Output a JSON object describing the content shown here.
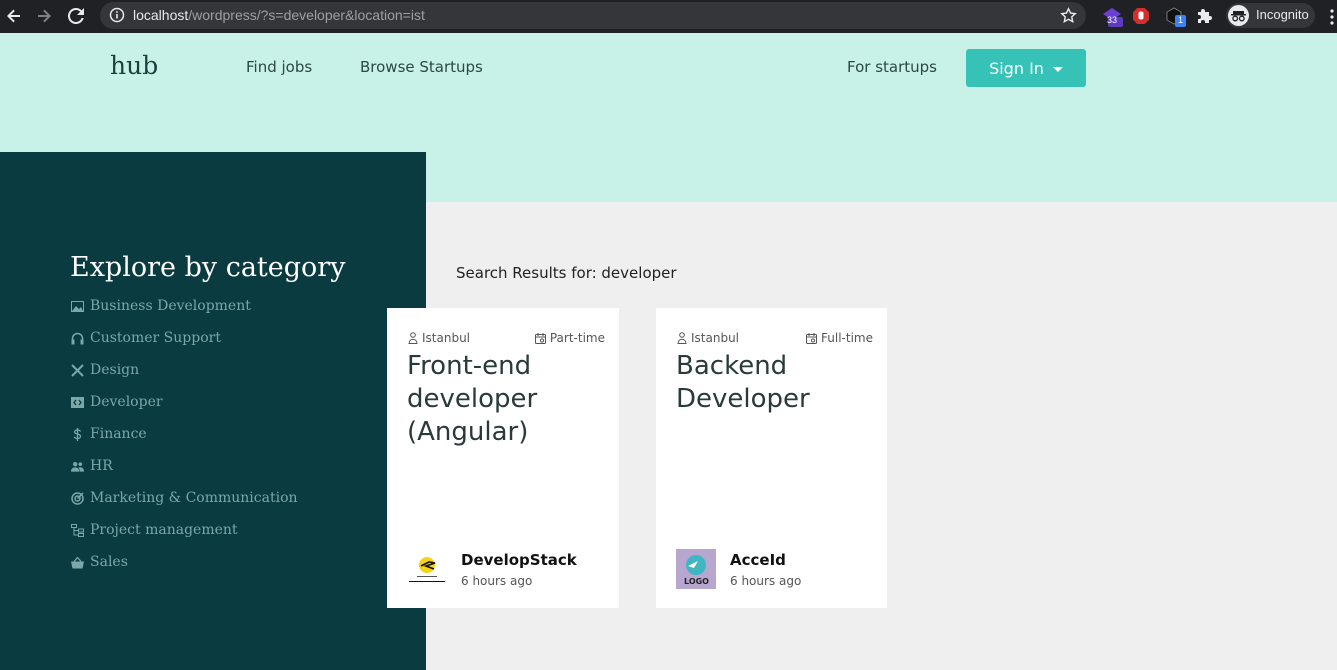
{
  "browser": {
    "url_host": "localhost",
    "url_path": "/wordpress/?s=developer&location=ist",
    "extension_badge_1": "33",
    "extension_badge_2": "1",
    "incognito_label": "Incognito"
  },
  "header": {
    "brand": "hub",
    "nav": [
      "Find jobs",
      "Browse Startups"
    ],
    "for_startups": "For startups",
    "sign_in": "Sign In"
  },
  "sidebar": {
    "title": "Explore by category",
    "categories": [
      {
        "label": "Business Development",
        "icon": "image-icon"
      },
      {
        "label": "Customer Support",
        "icon": "headphones-icon"
      },
      {
        "label": "Design",
        "icon": "design-tools-icon"
      },
      {
        "label": "Developer",
        "icon": "code-icon"
      },
      {
        "label": "Finance",
        "icon": "dollar-icon"
      },
      {
        "label": "HR",
        "icon": "people-icon"
      },
      {
        "label": "Marketing & Communication",
        "icon": "target-icon"
      },
      {
        "label": "Project management",
        "icon": "hierarchy-icon"
      },
      {
        "label": "Sales",
        "icon": "basket-icon"
      }
    ]
  },
  "results": {
    "title": "Search Results for: developer",
    "jobs": [
      {
        "location": "Istanbul",
        "type": "Part-time",
        "title": "Front-end developer (Angular)",
        "company": "DevelopStack",
        "posted": "6 hours ago"
      },
      {
        "location": "Istanbul",
        "type": "Full-time",
        "title": "Backend Developer",
        "company": "AcceId",
        "posted": "6 hours ago",
        "logo_text": "LOGO"
      }
    ]
  }
}
